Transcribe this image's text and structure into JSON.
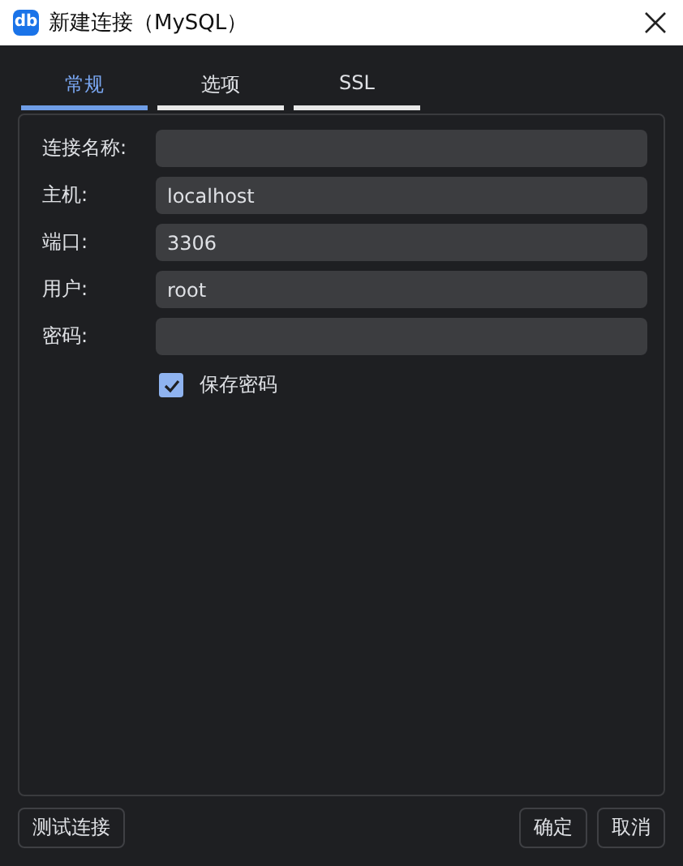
{
  "window": {
    "title": "新建连接（MySQL）",
    "app_icon": "db"
  },
  "tabs": [
    {
      "label": "常规",
      "selected": true
    },
    {
      "label": "选项",
      "selected": false
    },
    {
      "label": "SSL",
      "selected": false
    }
  ],
  "fields": [
    {
      "label": "连接名称:"
    },
    {
      "label": "主机:",
      "value": "localhost"
    },
    {
      "label": "端口:",
      "value": "3306"
    },
    {
      "label": "用户:",
      "value": "root"
    },
    {
      "label": "密码:"
    }
  ],
  "save_password": {
    "label": "保存密码",
    "checked": true
  },
  "buttons": {
    "test": "测试连接",
    "ok": "确定",
    "cancel": "取消"
  }
}
